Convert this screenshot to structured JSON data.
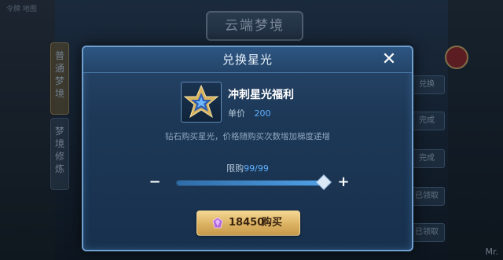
{
  "background": {
    "title": "云端梦境",
    "tab_top": "普通梦境",
    "tab_bottom": "梦境修炼",
    "right_buttons": [
      "兑换",
      "完成",
      "完成",
      "已领取",
      "已领取"
    ],
    "top_left_text": "令牌 地图"
  },
  "modal": {
    "title": "兑换星光",
    "close_icon": "close-icon",
    "item": {
      "icon": "star-badge-icon",
      "name": "冲刺星光福利",
      "price_label": "单价",
      "price_value": "200"
    },
    "description": "钻石购买星光，价格随购买次数增加梯度递增",
    "limit": {
      "label": "限购",
      "value": "99/99"
    },
    "slider": {
      "minus_icon": "minus-icon",
      "plus_icon": "plus-icon",
      "fraction": 1.0
    },
    "buy_button": {
      "icon": "diamond-icon",
      "amount": "18450",
      "label": "购买"
    }
  },
  "colors": {
    "accent_blue": "#5fb0ff",
    "gold_button": "#dbb262"
  },
  "watermark": "Mr."
}
